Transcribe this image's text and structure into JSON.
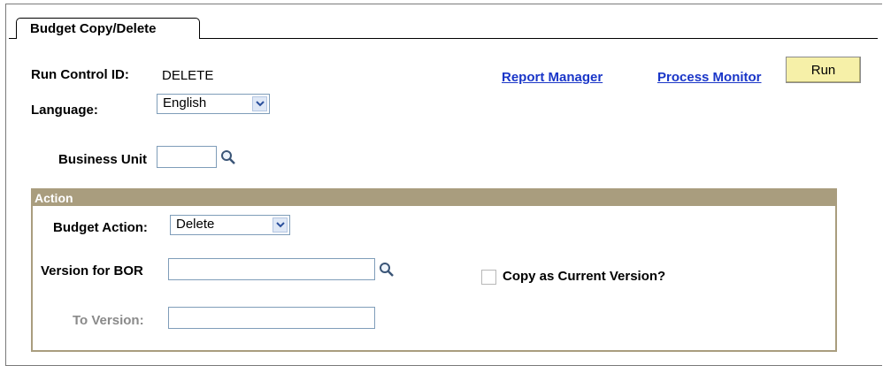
{
  "tab": {
    "label": "Budget Copy/Delete"
  },
  "run_control": {
    "label": "Run Control ID:",
    "value": "DELETE"
  },
  "language": {
    "label": "Language:",
    "value": "English"
  },
  "links": {
    "report_manager": "Report Manager",
    "process_monitor": "Process Monitor"
  },
  "run_button": "Run",
  "business_unit": {
    "label": "Business Unit",
    "value": ""
  },
  "action_group": {
    "title": "Action",
    "budget_action": {
      "label": "Budget Action:",
      "value": "Delete"
    },
    "version_for_bor": {
      "label": "Version for BOR",
      "value": ""
    },
    "copy_as_current": {
      "label": "Copy as Current Version?",
      "checked": false
    },
    "to_version": {
      "label": "To Version:",
      "value": ""
    }
  },
  "icons": {
    "lookup": "magnifier-icon",
    "dropdown": "chevron-down-icon"
  }
}
